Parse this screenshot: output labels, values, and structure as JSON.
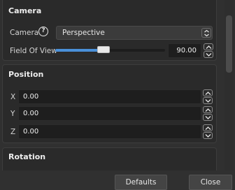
{
  "camera": {
    "title": "Camera",
    "camera_label": "Camera",
    "help_glyph": "?",
    "camera_value": "Perspective",
    "fov_label": "Field Of View",
    "fov_value": "90.00",
    "fov_slider_fraction": 0.44
  },
  "position": {
    "title": "Position",
    "x_label": "X",
    "x_value": "0.00",
    "y_label": "Y",
    "y_value": "0.00",
    "z_label": "Z",
    "z_value": "0.00"
  },
  "rotation": {
    "title": "Rotation"
  },
  "footer": {
    "defaults_label": "Defaults",
    "close_label": "Close"
  },
  "colors": {
    "background": "#303030",
    "panel": "#2a2a2a",
    "accent": "#4a90d9",
    "field": "#1e1e1e"
  },
  "icons": [
    "help-icon",
    "combo-arrows-icon",
    "chevron-up-icon",
    "chevron-down-icon"
  ]
}
